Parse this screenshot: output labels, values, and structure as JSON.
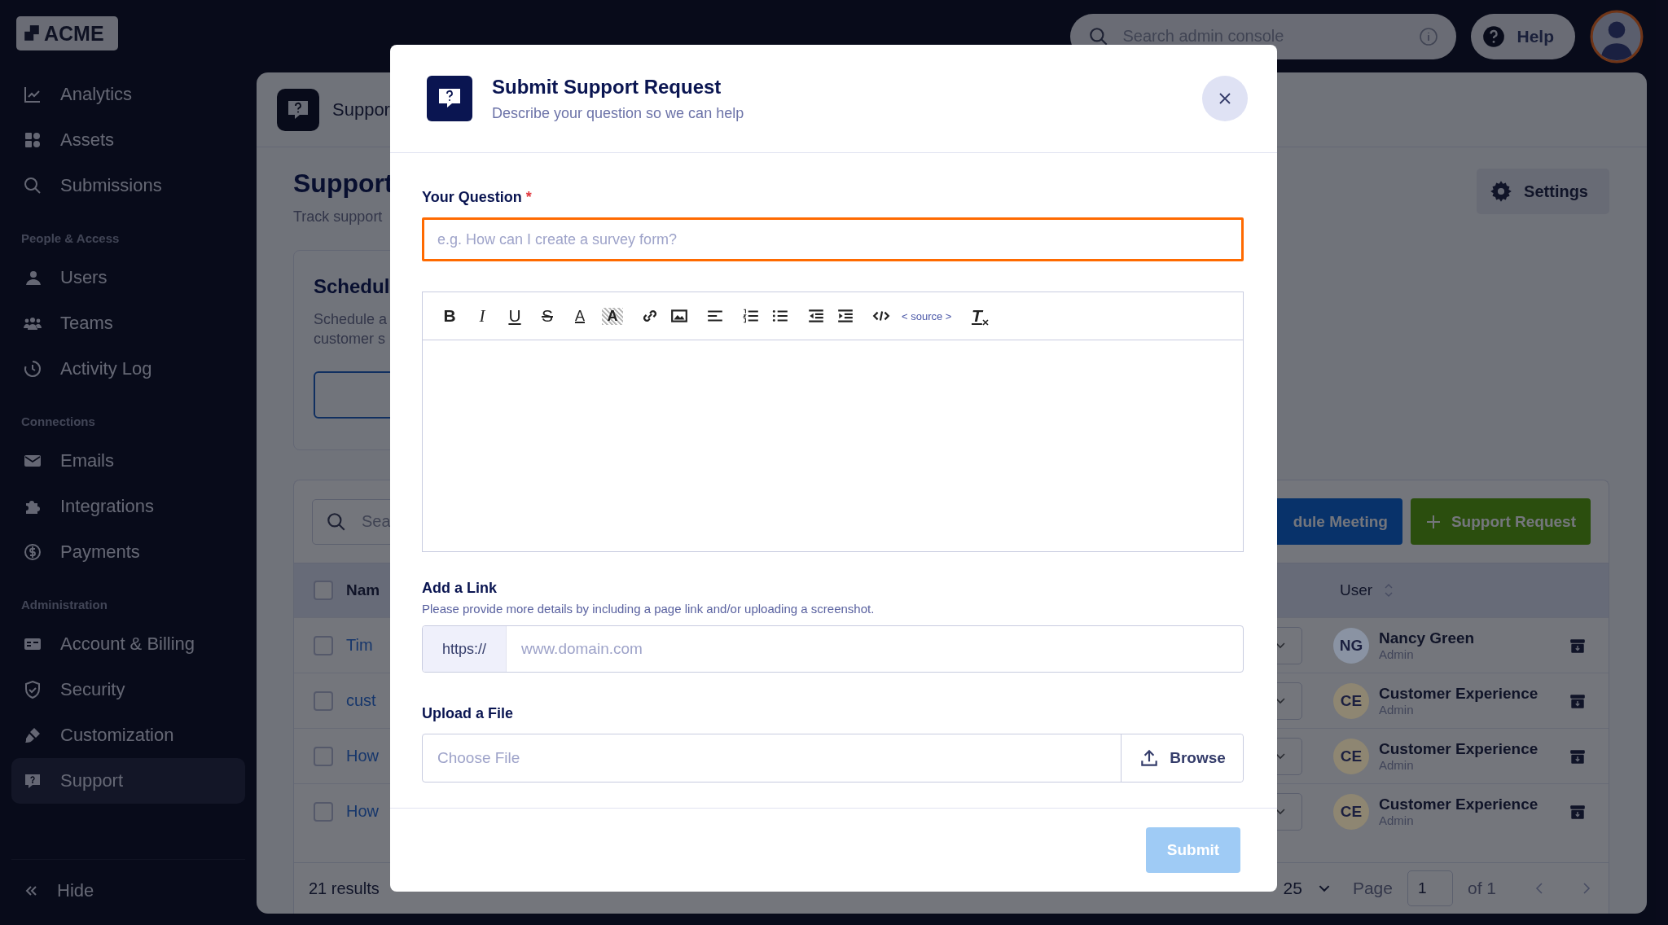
{
  "topbar": {
    "search": {
      "placeholder": "Search admin console"
    },
    "help_button": "Help"
  },
  "sidebar": {
    "logo": "ACME",
    "sections": [
      {
        "items": [
          {
            "label": "Analytics",
            "selected": false
          },
          {
            "label": "Assets",
            "selected": false
          },
          {
            "label": "Submissions",
            "selected": false
          }
        ]
      },
      {
        "heading": "People & Access",
        "items": [
          {
            "label": "Users",
            "selected": false
          },
          {
            "label": "Teams",
            "selected": false
          },
          {
            "label": "Activity Log",
            "selected": false
          }
        ]
      },
      {
        "heading": "Connections",
        "items": [
          {
            "label": "Emails",
            "selected": false
          },
          {
            "label": "Integrations",
            "selected": false
          },
          {
            "label": "Payments",
            "selected": false
          }
        ]
      },
      {
        "heading": "Administration",
        "items": [
          {
            "label": "Account & Billing",
            "selected": false
          },
          {
            "label": "Security",
            "selected": false
          },
          {
            "label": "Customization",
            "selected": false
          },
          {
            "label": "Support",
            "selected": true
          }
        ]
      }
    ],
    "hide_button": "Hide"
  },
  "page": {
    "breadcrumb": "Suppor",
    "title": "Support",
    "subtitle": "Track support",
    "settings_button": "Settings",
    "schedule_card": {
      "title": "Schedul",
      "text_lines": [
        "Schedule a",
        "customer s"
      ]
    },
    "table": {
      "search_placeholder": "Sea",
      "buttons": [
        {
          "label": "dule Meeting",
          "kind": "meeting"
        },
        {
          "label": "Support Request",
          "kind": "request"
        }
      ],
      "columns": [
        "Nam",
        "User"
      ],
      "header_checked": false,
      "rows": [
        {
          "checked": false,
          "name": "Tim",
          "user_initials": "NG",
          "user_name": "Nancy Green",
          "user_role": "Admin",
          "color": "#8a93a3"
        },
        {
          "checked": false,
          "name": "cust",
          "user_initials": "CE",
          "user_name": "Customer Experience",
          "user_role": "Admin",
          "color": "#8e8672"
        },
        {
          "checked": false,
          "name": "How",
          "user_initials": "CE",
          "user_name": "Customer Experience",
          "user_role": "Admin",
          "color": "#8e8672"
        },
        {
          "checked": false,
          "name": "How",
          "user_initials": "CE",
          "user_name": "Customer Experience",
          "user_role": "Admin",
          "color": "#8e8672"
        }
      ],
      "footer": {
        "results": "21 results",
        "page_size": "25",
        "page_label": "Page",
        "page_value": "1",
        "page_total": "of 1"
      }
    }
  },
  "modal": {
    "title": "Submit Support Request",
    "subtitle": "Describe your question so we can help",
    "question": {
      "label": "Your Question",
      "required_mark": "*",
      "placeholder": "e.g. How can I create a survey form?",
      "focused": true
    },
    "toolbar": [
      [
        {
          "kind": "bold",
          "label": "B"
        },
        {
          "kind": "italic",
          "label": "I"
        },
        {
          "kind": "underline",
          "label": "U"
        },
        {
          "kind": "strike",
          "label": "S"
        },
        {
          "kind": "color",
          "label": "A"
        },
        {
          "kind": "highlight",
          "label": "A"
        }
      ],
      [
        {
          "kind": "link"
        },
        {
          "kind": "image"
        }
      ],
      [
        {
          "kind": "align"
        }
      ],
      [
        {
          "kind": "ol"
        },
        {
          "kind": "ul"
        }
      ],
      [
        {
          "kind": "outdent"
        },
        {
          "kind": "indent"
        }
      ],
      [
        {
          "kind": "code"
        },
        {
          "kind": "source",
          "label": "< source >"
        }
      ],
      [
        {
          "kind": "clear",
          "label": "T"
        }
      ]
    ],
    "link": {
      "label": "Add a Link",
      "hint": "Please provide more details by including a page link and/or uploading a screenshot.",
      "prefix": "https://",
      "placeholder": "www.domain.com"
    },
    "file": {
      "label": "Upload a File",
      "placeholder": "Choose File",
      "browse_button": "Browse"
    },
    "submit_button": {
      "label": "Submit",
      "disabled": true
    }
  }
}
